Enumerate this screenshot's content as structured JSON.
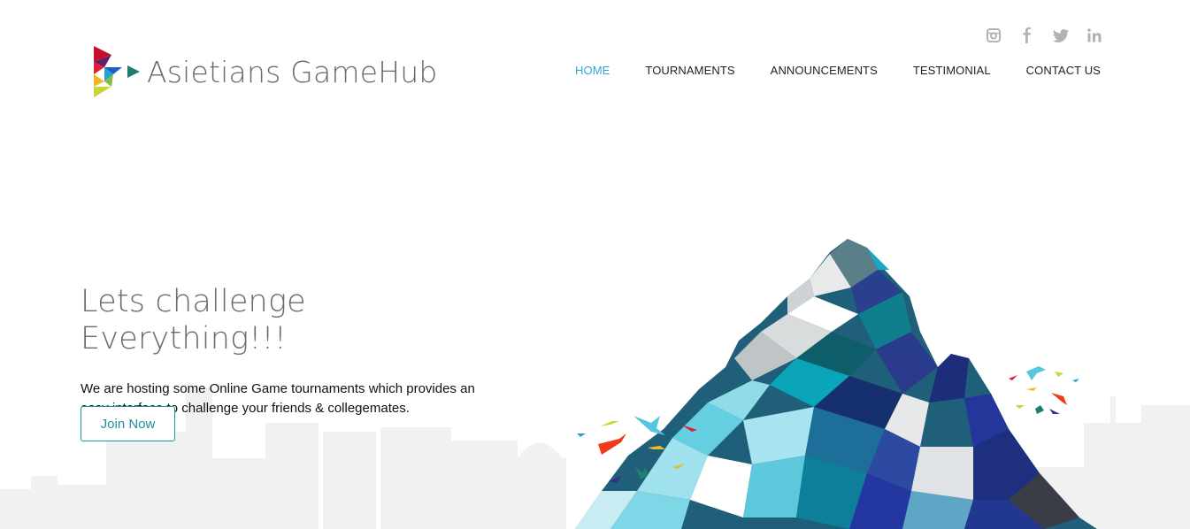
{
  "brand": {
    "name": "Asietians GameHub"
  },
  "social": [
    {
      "icon": "instagram-icon"
    },
    {
      "icon": "facebook-icon"
    },
    {
      "icon": "twitter-icon"
    },
    {
      "icon": "linkedin-icon"
    }
  ],
  "nav": {
    "home": "HOME",
    "tournaments": "TOURNAMENTS",
    "announcements": "ANNOUNCEMENTS",
    "testimonial": "TESTIMONIAL",
    "contact": "CONTACT US"
  },
  "hero": {
    "title": "Lets challenge Everything!!!",
    "description": "We are hosting some Online Game tournaments which provides an easy interface to challenge your friends & collegemates.",
    "cta": "Join Now"
  },
  "colors": {
    "accent": "#29a8d8",
    "button": "#1c8fa2",
    "text_muted": "#6b6b6b"
  }
}
